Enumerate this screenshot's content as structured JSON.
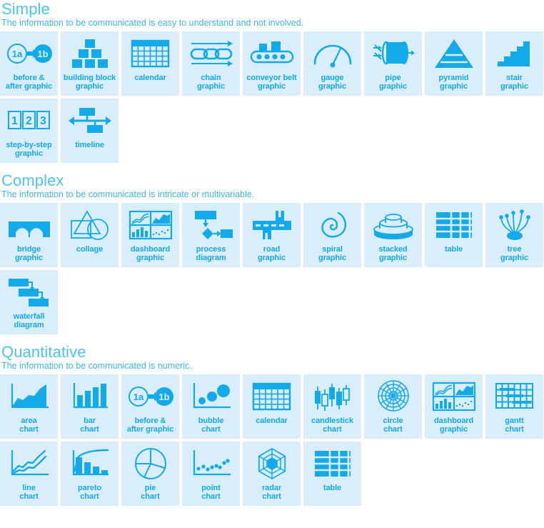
{
  "colors": {
    "accent": "#14a9e8",
    "tile_bg": "#d9eefa",
    "heading": "#4ec3f0",
    "description": "#3fb8ec",
    "page_bg": "#ffffff"
  },
  "sections": [
    {
      "id": "simple",
      "title": "Simple",
      "description": "The information to be communicated is easy to understand and not involved.",
      "tiles": [
        {
          "icon": "before-after-graphic-icon",
          "label": "before &\nafter graphic",
          "label_lines": [
            "before &",
            "after graphic"
          ]
        },
        {
          "icon": "building-block-graphic-icon",
          "label": "building block\ngraphic",
          "label_lines": [
            "building block",
            "graphic"
          ]
        },
        {
          "icon": "calendar-icon",
          "label": "calendar",
          "label_lines": [
            "calendar"
          ]
        },
        {
          "icon": "chain-graphic-icon",
          "label": "chain\ngraphic",
          "label_lines": [
            "chain",
            "graphic"
          ]
        },
        {
          "icon": "conveyor-belt-graphic-icon",
          "label": "conveyor belt\ngraphic",
          "label_lines": [
            "conveyor belt",
            "graphic"
          ]
        },
        {
          "icon": "gauge-graphic-icon",
          "label": "gauge\ngraphic",
          "label_lines": [
            "gauge",
            "graphic"
          ]
        },
        {
          "icon": "pipe-graphic-icon",
          "label": "pipe\ngraphic",
          "label_lines": [
            "pipe",
            "graphic"
          ]
        },
        {
          "icon": "pyramid-graphic-icon",
          "label": "pyramid\ngraphic",
          "label_lines": [
            "pyramid",
            "graphic"
          ]
        },
        {
          "icon": "stair-graphic-icon",
          "label": "stair\ngraphic",
          "label_lines": [
            "stair",
            "graphic"
          ]
        },
        {
          "icon": "step-by-step-graphic-icon",
          "label": "step-by-step\ngraphic",
          "label_lines": [
            "step-by-step",
            "graphic"
          ]
        },
        {
          "icon": "timeline-icon",
          "label": "timeline",
          "label_lines": [
            "timeline"
          ]
        }
      ]
    },
    {
      "id": "complex",
      "title": "Complex",
      "description": "The information to be communicated is intricate or multivariable.",
      "tiles": [
        {
          "icon": "bridge-graphic-icon",
          "label": "bridge\ngraphic",
          "label_lines": [
            "bridge",
            "graphic"
          ]
        },
        {
          "icon": "collage-icon",
          "label": "collage",
          "label_lines": [
            "collage"
          ]
        },
        {
          "icon": "dashboard-graphic-icon",
          "label": "dashboard\ngraphic",
          "label_lines": [
            "dashboard",
            "graphic"
          ]
        },
        {
          "icon": "process-diagram-icon",
          "label": "process\ndiagram",
          "label_lines": [
            "process",
            "diagram"
          ]
        },
        {
          "icon": "road-graphic-icon",
          "label": "road\ngraphic",
          "label_lines": [
            "road",
            "graphic"
          ]
        },
        {
          "icon": "spiral-graphic-icon",
          "label": "spiral\ngraphic",
          "label_lines": [
            "spiral",
            "graphic"
          ]
        },
        {
          "icon": "stacked-graphic-icon",
          "label": "stacked\ngraphic",
          "label_lines": [
            "stacked",
            "graphic"
          ]
        },
        {
          "icon": "table-icon",
          "label": "table",
          "label_lines": [
            "table"
          ]
        },
        {
          "icon": "tree-graphic-icon",
          "label": "tree\ngraphic",
          "label_lines": [
            "tree",
            "graphic"
          ]
        },
        {
          "icon": "waterfall-diagram-icon",
          "label": "waterfall\ndiagram",
          "label_lines": [
            "waterfall",
            "diagram"
          ]
        }
      ]
    },
    {
      "id": "quantitative",
      "title": "Quantitative",
      "description": "The information to be communicated is numeric.",
      "tiles": [
        {
          "icon": "area-chart-icon",
          "label": "area\nchart",
          "label_lines": [
            "area",
            "chart"
          ]
        },
        {
          "icon": "bar-chart-icon",
          "label": "bar\nchart",
          "label_lines": [
            "bar",
            "chart"
          ]
        },
        {
          "icon": "before-after-graphic-icon",
          "label": "before &\nafter graphic",
          "label_lines": [
            "before &",
            "after graphic"
          ]
        },
        {
          "icon": "bubble-chart-icon",
          "label": "bubble\nchart",
          "label_lines": [
            "bubble",
            "chart"
          ]
        },
        {
          "icon": "calendar-icon",
          "label": "calendar",
          "label_lines": [
            "calendar"
          ]
        },
        {
          "icon": "candlestick-chart-icon",
          "label": "candlestick\nchart",
          "label_lines": [
            "candlestick",
            "chart"
          ]
        },
        {
          "icon": "circle-chart-icon",
          "label": "circle\nchart",
          "label_lines": [
            "circle",
            "chart"
          ]
        },
        {
          "icon": "dashboard-graphic-icon",
          "label": "dashboard\ngraphic",
          "label_lines": [
            "dashboard",
            "graphic"
          ]
        },
        {
          "icon": "gantt-chart-icon",
          "label": "gantt\nchart",
          "label_lines": [
            "gantt",
            "chart"
          ]
        },
        {
          "icon": "line-chart-icon",
          "label": "line\nchart",
          "label_lines": [
            "line",
            "chart"
          ]
        },
        {
          "icon": "pareto-chart-icon",
          "label": "pareto\nchart",
          "label_lines": [
            "pareto",
            "chart"
          ]
        },
        {
          "icon": "pie-chart-icon",
          "label": "pie\nchart",
          "label_lines": [
            "pie",
            "chart"
          ]
        },
        {
          "icon": "point-chart-icon",
          "label": "point\nchart",
          "label_lines": [
            "point",
            "chart"
          ]
        },
        {
          "icon": "radar-chart-icon",
          "label": "radar\nchart",
          "label_lines": [
            "radar",
            "chart"
          ]
        },
        {
          "icon": "table-icon",
          "label": "table",
          "label_lines": [
            "table"
          ]
        }
      ]
    }
  ],
  "icon_text": {
    "before_a": "1a",
    "before_b": "1b",
    "step_1": "1",
    "step_2": "2",
    "step_3": "3"
  }
}
